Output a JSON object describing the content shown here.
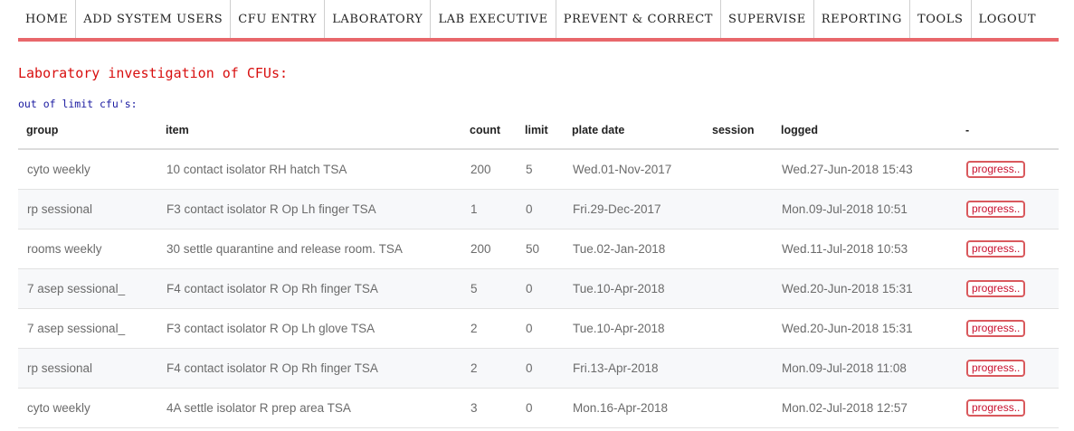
{
  "nav": {
    "items": [
      "HOME",
      "ADD SYSTEM USERS",
      "CFU ENTRY",
      "LABORATORY",
      "LAB EXECUTIVE",
      "PREVENT & CORRECT",
      "SUPERVISE",
      "REPORTING",
      "TOOLS",
      "LOGOUT"
    ]
  },
  "page": {
    "title": "Laboratory investigation of CFUs:",
    "subheading": "out of limit cfu's:"
  },
  "table": {
    "headers": [
      "group",
      "item",
      "count",
      "limit",
      "plate date",
      "session",
      "logged",
      "-"
    ],
    "rows": [
      [
        "cyto weekly",
        "10 contact isolator RH hatch TSA",
        "200",
        "5",
        "Wed.01-Nov-2017",
        "",
        "Wed.27-Jun-2018 15:43",
        "progress.."
      ],
      [
        "rp sessional",
        "F3 contact isolator R Op Lh finger TSA",
        "1",
        "0",
        "Fri.29-Dec-2017",
        "",
        "Mon.09-Jul-2018 10:51",
        "progress.."
      ],
      [
        "rooms weekly",
        "30 settle quarantine and release room. TSA",
        "200",
        "50",
        "Tue.02-Jan-2018",
        "",
        "Wed.11-Jul-2018 10:53",
        "progress.."
      ],
      [
        "7 asep sessional_",
        "F4 contact isolator R Op Rh finger TSA",
        "5",
        "0",
        "Tue.10-Apr-2018",
        "",
        "Wed.20-Jun-2018 15:31",
        "progress.."
      ],
      [
        "7 asep sessional_",
        "F3 contact isolator R Op Lh glove TSA",
        "2",
        "0",
        "Tue.10-Apr-2018",
        "",
        "Wed.20-Jun-2018 15:31",
        "progress.."
      ],
      [
        "rp sessional",
        "F4 contact isolator R Op Rh finger TSA",
        "2",
        "0",
        "Fri.13-Apr-2018",
        "",
        "Mon.09-Jul-2018 11:08",
        "progress.."
      ],
      [
        "cyto weekly",
        "4A settle isolator R prep area TSA",
        "3",
        "0",
        "Mon.16-Apr-2018",
        "",
        "Mon.02-Jul-2018 12:57",
        "progress.."
      ]
    ]
  },
  "colors": {
    "nav_bar": "#e8676b",
    "title": "#d80f0f",
    "subheading": "#1a1aa0",
    "progress_border": "#d9595d"
  }
}
